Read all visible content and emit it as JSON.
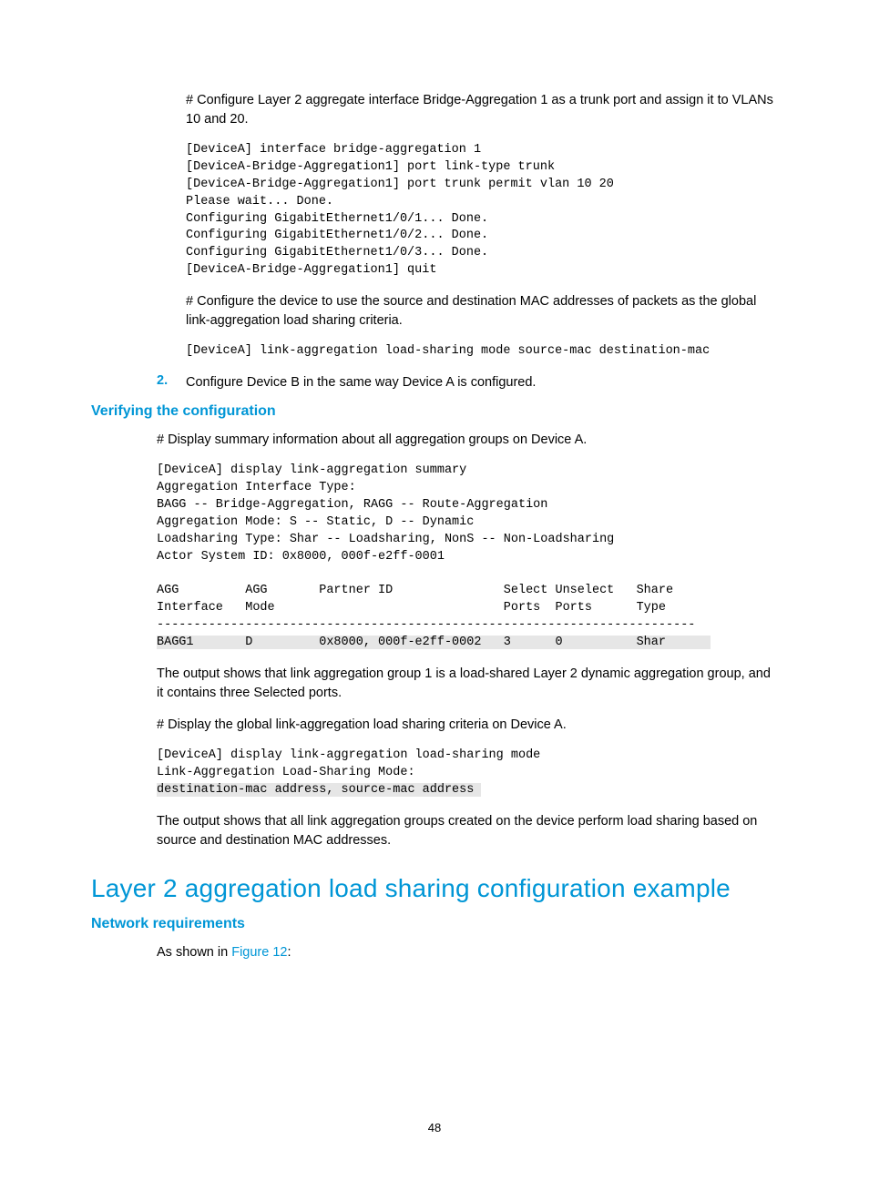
{
  "p1": "# Configure Layer 2 aggregate interface Bridge-Aggregation 1 as a trunk port and assign it to VLANs 10 and 20.",
  "code1": "[DeviceA] interface bridge-aggregation 1\n[DeviceA-Bridge-Aggregation1] port link-type trunk\n[DeviceA-Bridge-Aggregation1] port trunk permit vlan 10 20\nPlease wait... Done.\nConfiguring GigabitEthernet1/0/1... Done.\nConfiguring GigabitEthernet1/0/2... Done.\nConfiguring GigabitEthernet1/0/3... Done.\n[DeviceA-Bridge-Aggregation1] quit",
  "p2": "# Configure the device to use the source and destination MAC addresses of packets as the global link-aggregation load sharing criteria.",
  "code2": "[DeviceA] link-aggregation load-sharing mode source-mac destination-mac",
  "step2_num": "2.",
  "step2_txt": "Configure Device B in the same way Device A is configured.",
  "h3a": "Verifying the configuration",
  "p3": "# Display summary information about all aggregation groups on Device A.",
  "code3_pre": "[DeviceA] display link-aggregation summary\nAggregation Interface Type:\nBAGG -- Bridge-Aggregation, RAGG -- Route-Aggregation\nAggregation Mode: S -- Static, D -- Dynamic\nLoadsharing Type: Shar -- Loadsharing, NonS -- Non-Loadsharing\nActor System ID: 0x8000, 000f-e2ff-0001\n\nAGG         AGG       Partner ID               Select Unselect   Share\nInterface   Mode                               Ports  Ports      Type\n-------------------------------------------------------------------------\n",
  "code3_hl": "BAGG1       D         0x8000, 000f-e2ff-0002   3      0          Shar      ",
  "p4": "The output shows that link aggregation group 1 is a load-shared Layer 2 dynamic aggregation group, and it contains three Selected ports.",
  "p5": "# Display the global link-aggregation load sharing criteria on Device A.",
  "code4_pre": "[DeviceA] display link-aggregation load-sharing mode\nLink-Aggregation Load-Sharing Mode:\n",
  "code4_hl": "destination-mac address, source-mac address ",
  "p6": "The output shows that all link aggregation groups created on the device perform load sharing based on source and destination MAC addresses.",
  "h2": "Layer 2 aggregation load sharing configuration example",
  "h3b": "Network requirements",
  "p7a": "As shown in ",
  "p7link": "Figure 12",
  "p7b": ":",
  "pagenum": "48"
}
